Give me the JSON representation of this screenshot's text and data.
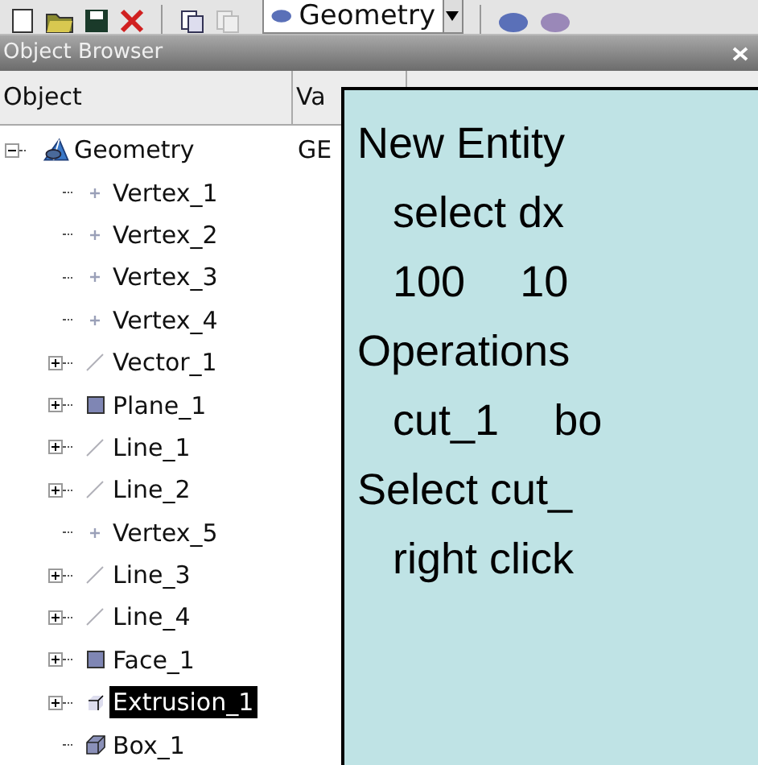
{
  "toolbar": {
    "module_combo": {
      "value": "Geometry"
    }
  },
  "object_browser": {
    "title": "Object Browser",
    "columns": [
      "Object",
      "Va"
    ],
    "tree": [
      {
        "label": "Geometry",
        "value": "GE",
        "kind": "root",
        "expanded": true,
        "selected": false,
        "children": [
          {
            "label": "Vertex_1",
            "kind": "vertex",
            "expandable": false,
            "selected": false
          },
          {
            "label": "Vertex_2",
            "kind": "vertex",
            "expandable": false,
            "selected": false
          },
          {
            "label": "Vertex_3",
            "kind": "vertex",
            "expandable": false,
            "selected": false
          },
          {
            "label": "Vertex_4",
            "kind": "vertex",
            "expandable": false,
            "selected": false
          },
          {
            "label": "Vector_1",
            "kind": "line",
            "expandable": true,
            "selected": false
          },
          {
            "label": "Plane_1",
            "kind": "plane",
            "expandable": true,
            "selected": false
          },
          {
            "label": "Line_1",
            "kind": "line",
            "expandable": true,
            "selected": false
          },
          {
            "label": "Line_2",
            "kind": "line",
            "expandable": true,
            "selected": false
          },
          {
            "label": "Vertex_5",
            "kind": "vertex",
            "expandable": false,
            "selected": false
          },
          {
            "label": "Line_3",
            "kind": "line",
            "expandable": true,
            "selected": false
          },
          {
            "label": "Line_4",
            "kind": "line",
            "expandable": true,
            "selected": false
          },
          {
            "label": "Face_1",
            "kind": "plane",
            "expandable": true,
            "selected": false
          },
          {
            "label": "Extrusion_1",
            "kind": "extrusion",
            "expandable": true,
            "selected": true
          },
          {
            "label": "Box_1",
            "kind": "box",
            "expandable": false,
            "selected": false
          }
        ]
      }
    ]
  },
  "note": {
    "lines": [
      {
        "parts": [
          "New Entity"
        ],
        "indent": false
      },
      {
        "parts": [
          "select dx"
        ],
        "indent": true
      },
      {
        "parts": [
          "100",
          "10"
        ],
        "indent": true
      },
      {
        "parts": [
          "Operations"
        ],
        "indent": false
      },
      {
        "parts": [
          "cut_1",
          "bo"
        ],
        "indent": true
      },
      {
        "parts": [
          "Select cut_"
        ],
        "indent": false
      },
      {
        "parts": [
          "right click"
        ],
        "indent": true
      }
    ]
  }
}
